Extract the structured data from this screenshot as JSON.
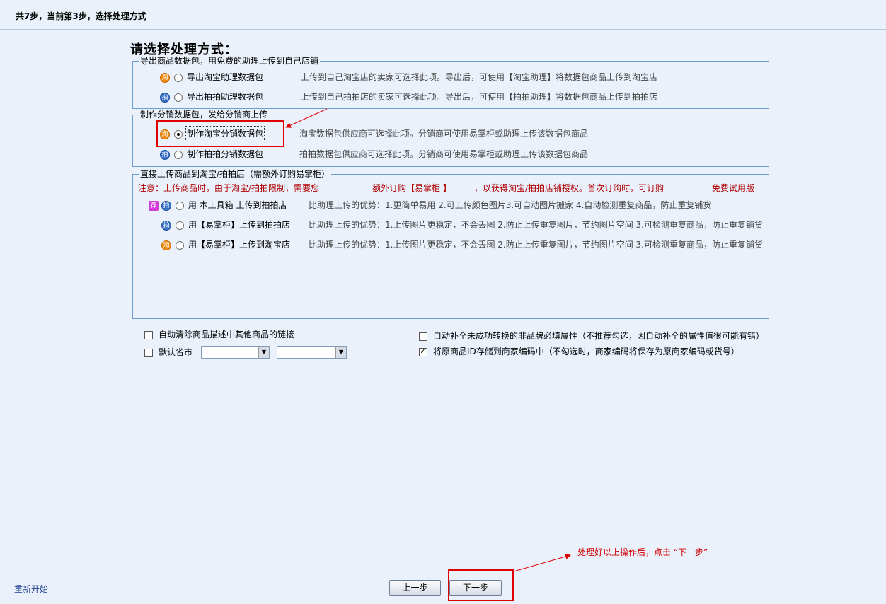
{
  "header": {
    "step_text": "共7步，当前第3步，选择处理方式"
  },
  "page_title": "请选择处理方式：",
  "group_export": {
    "legend": "导出商品数据包，用免费的助理上传到自己店铺",
    "options": [
      {
        "icon": "淘",
        "label": "导出淘宝助理数据包",
        "desc": "上传到自己淘宝店的卖家可选择此项。导出后，可使用【淘宝助理】将数据包商品上传到淘宝店"
      },
      {
        "icon": "拍",
        "label": "导出拍拍助理数据包",
        "desc": "上传到自己拍拍店的卖家可选择此项。导出后，可使用【拍拍助理】将数据包商品上传到拍拍店"
      }
    ]
  },
  "group_dist": {
    "legend": "制作分销数据包，发给分销商上传",
    "options": [
      {
        "icon": "淘",
        "label": "制作淘宝分销数据包",
        "desc": "淘宝数据包供应商可选择此项。分销商可使用易掌柜或助理上传该数据包商品",
        "selected": true
      },
      {
        "icon": "拍",
        "label": "制作拍拍分销数据包",
        "desc": "拍拍数据包供应商可选择此项。分销商可使用易掌柜或助理上传该数据包商品"
      }
    ]
  },
  "group_direct": {
    "legend": "直接上传商品到淘宝/拍拍店（需额外订购易掌柜）",
    "note_1": "注意：上传商品时，由于淘宝/拍拍限制，需要您",
    "note_2": "额外订购【易掌柜 】",
    "note_3": "，以获得淘宝/拍拍店铺授权。首次订购时，可订购",
    "note_4": "免费试用版",
    "options": [
      {
        "icons": [
          "荐",
          "拍"
        ],
        "label": "用 本工具箱 上传到拍拍店",
        "desc": "比助理上传的优势：1.更简单易用 2.可上传颜色图片3.可自动图片搬家 4.自动检测重复商品，防止重复铺货"
      },
      {
        "icons": [
          "拍"
        ],
        "label": "用【易掌柜】上传到拍拍店",
        "desc": "比助理上传的优势：1.上传图片更稳定，不会丢图 2.防止上传重复图片，节约图片空间 3.可检测重复商品，防止重复铺货"
      },
      {
        "icons": [
          "淘"
        ],
        "label": "用【易掌柜】上传到淘宝店",
        "desc": "比助理上传的优势：1.上传图片更稳定，不会丢图 2.防止上传重复图片，节约图片空间 3.可检测重复商品，防止重复铺货"
      }
    ]
  },
  "options": {
    "clear_links": {
      "label": "自动清除商品描述中其他商品的链接",
      "checked": false
    },
    "default_region": {
      "label": "默认省市",
      "checked": false,
      "province": "",
      "city": ""
    },
    "auto_fill": {
      "label": "自动补全未成功转换的非品牌必填属性（不推荐勾选，因自动补全的属性值很可能有错）",
      "checked": false
    },
    "store_id": {
      "label": "将原商品ID存储到商家编码中（不勾选时，商家编码将保存为原商家编码或货号）",
      "checked": true
    }
  },
  "annotation": "处理好以上操作后，点击 “下一步”",
  "footer": {
    "restart": "重新开始",
    "prev": "上一步",
    "next": "下一步"
  },
  "colors": {
    "accent_red": "#e00000",
    "note_red": "#b00000",
    "border_blue": "#6b9fd3",
    "taobao_orange": "#f08a12",
    "paipai_blue": "#3a73c9",
    "recommend_magenta": "#d13ed6"
  }
}
